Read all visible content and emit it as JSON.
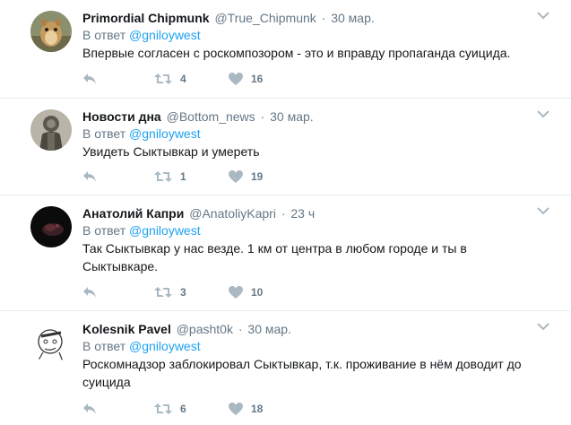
{
  "colors": {
    "link": "#1da1f2",
    "meta": "#657786",
    "icon": "#aab8c2",
    "divider": "#e6ecf0",
    "text": "#14171a"
  },
  "icons": {
    "reply": "reply-arrow-icon",
    "retweet": "retweet-icon",
    "like": "heart-icon",
    "more": "chevron-down-icon"
  },
  "reply_prefix": "В ответ",
  "tweets": [
    {
      "fullname": "Primordial Chipmunk",
      "username": "@True_Chipmunk",
      "sep": "·",
      "time": "30 мар.",
      "reply_mention": "@gniloywest",
      "text": "Впервые согласен с роскомпозором - это и вправду пропаганда суицида.",
      "retweets": "4",
      "likes": "16"
    },
    {
      "fullname": "Новости дна",
      "username": "@Bottom_news",
      "sep": "·",
      "time": "30 мар.",
      "reply_mention": "@gniloywest",
      "text": "Увидеть Сыктывкар и умереть",
      "retweets": "1",
      "likes": "19"
    },
    {
      "fullname": "Анатолий Капри",
      "username": "@AnatoliyKapri",
      "sep": "·",
      "time": "23 ч",
      "reply_mention": "@gniloywest",
      "text": "Так Сыктывкар у нас везде. 1 км от центра в любом городе и ты в Сыктывкаре.",
      "retweets": "3",
      "likes": "10"
    },
    {
      "fullname": "Kolesnik Pavel",
      "username": "@pasht0k",
      "sep": "·",
      "time": "30 мар.",
      "reply_mention": "@gniloywest",
      "text": "Роскомнадзор заблокировал Сыктывкар, т.к. проживание в нём доводит до суицида",
      "retweets": "6",
      "likes": "18"
    }
  ]
}
